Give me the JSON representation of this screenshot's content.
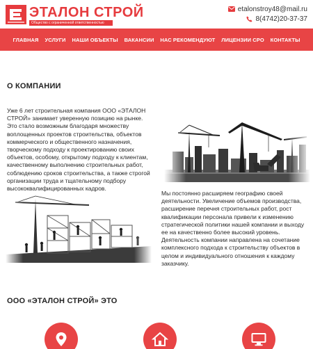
{
  "header": {
    "logo_title": "ЭТАЛОН СТРОЙ",
    "logo_subtitle": "Общество с ограниченной ответственностью",
    "email": "etalonstroy48@mail.ru",
    "phone": "8(4742)20-37-37",
    "email_icon": "envelope-icon",
    "phone_icon": "phone-icon"
  },
  "nav": {
    "items": [
      "ГЛАВНАЯ",
      "УСЛУГИ",
      "НАШИ ОБЪЕКТЫ",
      "ВАКАНСИИ",
      "НАС РЕКОМЕНДУЮТ",
      "ЛИЦЕНЗИИ СРО",
      "КОНТАКТЫ"
    ]
  },
  "about": {
    "title": "О КОМПАНИИ",
    "paragraph_1": "Уже 6 лет строительная компания ООО «ЭТАЛОН СТРОЙ» занимает уверенную позицию на рынке. Это стало возможным благодаря множеству воплощенных проектов строительства, объектов коммерческого и общественного назначения, творческому подходу к проектированию своих объектов, особому, открытому подходу к клиентам, качественному выполнению строительных работ, соблюдению сроков строительства, а также строгой организации труда и тщательному подбору высококвалифицированных кадров.",
    "paragraph_2": "Мы постоянно расширяем географию своей деятельности. Увеличение объемов производства, расширение перечня строительных работ, рост квалификации персонала привели к изменению стратегической политики нашей компании и выходу ее на качественно более высокий уровень. Деятельность компании направлена на сочетание комплексного подхода к строительству объектов в целом и индивидуального отношения к каждому заказчику."
  },
  "company": {
    "title": "ООО «ЭТАЛОН СТРОЙ» ЭТО",
    "icons": [
      "location-pin-icon",
      "house-icon",
      "monitor-icon"
    ]
  },
  "colors": {
    "brand_red": "#e84445",
    "text": "#222222"
  }
}
